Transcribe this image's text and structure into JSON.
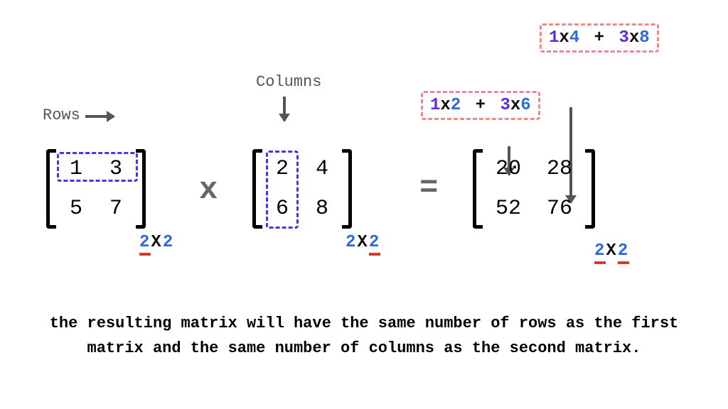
{
  "labels": {
    "rows": "Rows",
    "columns": "Columns"
  },
  "matrixA": {
    "c00": "1",
    "c01": "3",
    "c10": "5",
    "c11": "7"
  },
  "matrixB": {
    "c00": "2",
    "c01": "4",
    "c10": "6",
    "c11": "8"
  },
  "matrixC": {
    "c00": "20",
    "c01": "28",
    "c10": "52",
    "c11": "76"
  },
  "op": {
    "mult": "x",
    "eq": "="
  },
  "dims": {
    "a_left": "2",
    "a_x": "X",
    "a_right": "2",
    "b_left": "2",
    "b_x": "X",
    "b_right": "2",
    "c_left": "2",
    "c_x": "X",
    "c_right": "2"
  },
  "calc1": {
    "p1a": "1",
    "x1": "x",
    "p1b": "2",
    "plus": "+",
    "p2a": "3",
    "x2": "x",
    "p2b": "6"
  },
  "calc2": {
    "p1a": "1",
    "x1": "x",
    "p1b": "4",
    "plus": "+",
    "p2a": "3",
    "x2": "x",
    "p2b": "8"
  },
  "caption_line1": "the resulting matrix will have the same number of rows as the first",
  "caption_line2": "matrix and the same number of columns as the second matrix."
}
